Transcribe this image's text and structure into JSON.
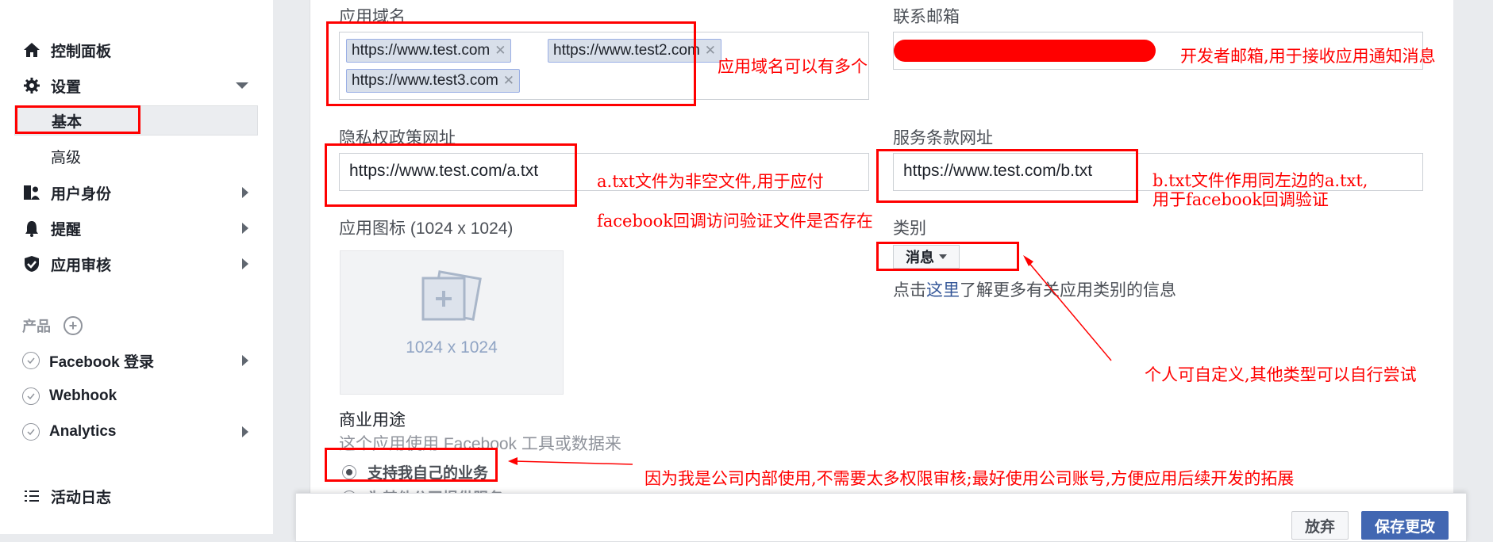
{
  "sidebar": {
    "dashboard": "控制面板",
    "settings": "设置",
    "settings_basic": "基本",
    "settings_advanced": "高级",
    "roles": "用户身份",
    "alerts": "提醒",
    "app_review": "应用审核",
    "products_label": "产品",
    "products": [
      "Facebook 登录",
      "Webhook",
      "Analytics"
    ],
    "activity_log": "活动日志"
  },
  "form": {
    "app_domains_label": "应用域名",
    "app_domains": [
      "https://www.test.com",
      "https://www.test2.com",
      "https://www.test3.com"
    ],
    "contact_email_label": "联系邮箱",
    "privacy_url_label": "隐私权政策网址",
    "privacy_url": "https://www.test.com/a.txt",
    "terms_url_label": "服务条款网址",
    "terms_url": "https://www.test.com/b.txt",
    "app_icon_label": "应用图标 (1024 x 1024)",
    "app_icon_size": "1024 x 1024",
    "category_label": "类别",
    "category_value": "消息",
    "category_help_prefix": "点击",
    "category_help_link": "这里",
    "category_help_suffix": "了解更多有关应用类别的信息",
    "business_use_label": "商业用途",
    "business_use_desc": "这个应用使用 Facebook 工具或数据来",
    "business_option_own": "支持我自己的业务",
    "business_option_other": "为其他公司提供服务"
  },
  "footer": {
    "discard": "放弃",
    "save": "保存更改"
  },
  "annotations": {
    "domains_note": "应用域名可以有多个",
    "email_note": "开发者邮箱,用于接收应用通知消息",
    "privacy_note_1": "a.txt文件为非空文件,用于应付",
    "privacy_note_2": "facebook回调访问验证文件是否存在",
    "terms_note_1": "b.txt文件作用同左边的a.txt,",
    "terms_note_2": "用于facebook回调验证",
    "category_note": "个人可自定义,其他类型可以自行尝试",
    "business_note": "因为我是公司内部使用,不需要太多权限审核;最好使用公司账号,方便应用后续开发的拓展"
  },
  "colors": {
    "annotation_red": "#ff0000",
    "fb_blue": "#4267b2",
    "link_blue": "#365899"
  }
}
